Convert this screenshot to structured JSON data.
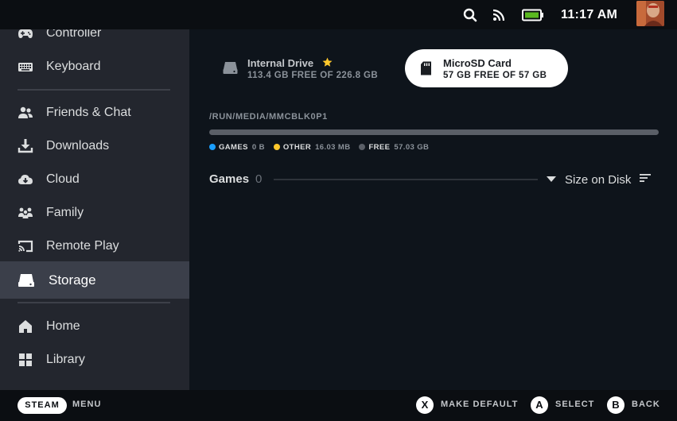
{
  "status_bar": {
    "time": "11:17 AM",
    "icons": [
      "search-icon",
      "rss-icon",
      "battery-icon"
    ]
  },
  "sidebar": {
    "items": [
      {
        "label": "Controller",
        "icon": "controller-icon"
      },
      {
        "label": "Keyboard",
        "icon": "keyboard-icon"
      },
      {
        "label": "Friends & Chat",
        "icon": "friends-icon"
      },
      {
        "label": "Downloads",
        "icon": "download-icon"
      },
      {
        "label": "Cloud",
        "icon": "cloud-icon"
      },
      {
        "label": "Family",
        "icon": "family-icon"
      },
      {
        "label": "Remote Play",
        "icon": "remote-play-icon"
      },
      {
        "label": "Storage",
        "icon": "storage-icon",
        "active": true
      },
      {
        "label": "Home",
        "icon": "home-icon"
      },
      {
        "label": "Library",
        "icon": "library-icon"
      }
    ]
  },
  "drives": {
    "internal": {
      "name": "Internal Drive",
      "free": "113.4 GB FREE OF 226.8 GB",
      "default": true
    },
    "sd": {
      "name": "MicroSD Card",
      "free": "57 GB FREE OF 57 GB",
      "selected": true
    }
  },
  "path": "/RUN/MEDIA/MMCBLK0P1",
  "legend": [
    {
      "name": "GAMES",
      "value": "0 B",
      "color": "#1a9fff"
    },
    {
      "name": "OTHER",
      "value": "16.03 MB",
      "color": "#ffc82c"
    },
    {
      "name": "FREE",
      "value": "57.03 GB",
      "color": "#5a5f67"
    }
  ],
  "games": {
    "title": "Games",
    "count": "0"
  },
  "sort": {
    "label": "Size on Disk"
  },
  "footer": {
    "steam": "STEAM",
    "menu": "MENU",
    "x_label": "MAKE DEFAULT",
    "a_label": "SELECT",
    "b_label": "BACK",
    "x_glyph": "X",
    "a_glyph": "A",
    "b_glyph": "B"
  },
  "colors": {
    "accent_blue": "#1a9fff",
    "accent_yellow": "#ffc82c",
    "sidebar_bg": "#23262e",
    "main_bg": "#0e141b"
  }
}
